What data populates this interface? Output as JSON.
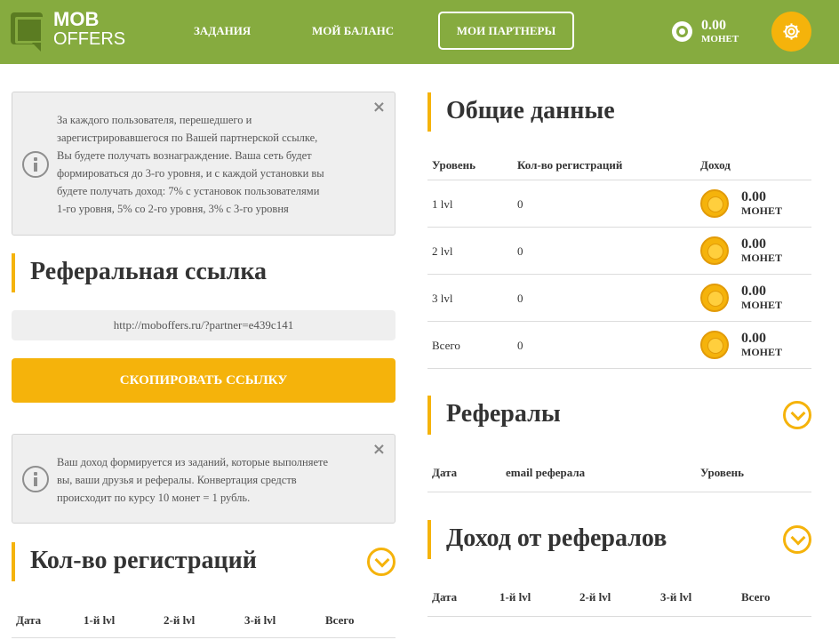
{
  "header": {
    "logo_top": "MOB",
    "logo_bottom": "OFFERS",
    "nav": [
      "ЗАДАНИЯ",
      "МОЙ БАЛАНС",
      "МОИ ПАРТНЕРЫ"
    ],
    "balance": {
      "amount": "0.00",
      "unit": "МОНЕТ"
    },
    "icons": {
      "balance": "coin-radio-icon",
      "settings": "gear-icon"
    },
    "colors": {
      "bar": "#86ab3f",
      "accent": "#f5b30b"
    }
  },
  "left": {
    "info1": {
      "lines": [
        "За каждого пользователя, перешедшего и",
        "зарегистрировавшегося по Вашей партнерской ссылке,",
        "Вы будете получать вознаграждение. Ваша сеть будет",
        "формироваться до 3-го уровня, и с каждой установки вы",
        "будете получать доход: 7% с установок пользователями",
        "1-го уровня, 5% со 2-го уровня, 3% с 3-го уровня"
      ],
      "close": "×"
    },
    "ref_title": "Реферальная ссылка",
    "ref_link": "http://moboffers.ru/?partner=e439c141",
    "copy_button": "СКОПИРОВАТЬ ССЫЛКУ",
    "info2": {
      "lines": [
        "Ваш доход формируется из заданий, которые выполняете",
        "вы, ваши друзья и рефералы. Конвертация средств",
        "происходит по курсу 10 монет = 1 рубль."
      ],
      "close": "×"
    },
    "reg_title": "Кол-во регистраций",
    "reg_columns": [
      "Дата",
      "1-й lvl",
      "2-й lvl",
      "3-й lvl",
      "Всего"
    ]
  },
  "right": {
    "summary_title": "Общие данные",
    "summary_columns": [
      "Уровень",
      "Кол-во регистраций",
      "Доход"
    ],
    "summary_rows": [
      {
        "level": "1 lvl",
        "count": "0",
        "amount": "0.00",
        "unit": "МОНЕТ"
      },
      {
        "level": "2 lvl",
        "count": "0",
        "amount": "0.00",
        "unit": "МОНЕТ"
      },
      {
        "level": "3 lvl",
        "count": "0",
        "amount": "0.00",
        "unit": "МОНЕТ"
      },
      {
        "level": "Всего",
        "count": "0",
        "amount": "0.00",
        "unit": "МОНЕТ"
      }
    ],
    "referrals_title": "Рефералы",
    "referrals_columns": [
      "Дата",
      "email реферала",
      "Уровень"
    ],
    "income_title": "Доход от рефералов",
    "income_columns": [
      "Дата",
      "1-й lvl",
      "2-й lvl",
      "3-й lvl",
      "Всего"
    ]
  }
}
